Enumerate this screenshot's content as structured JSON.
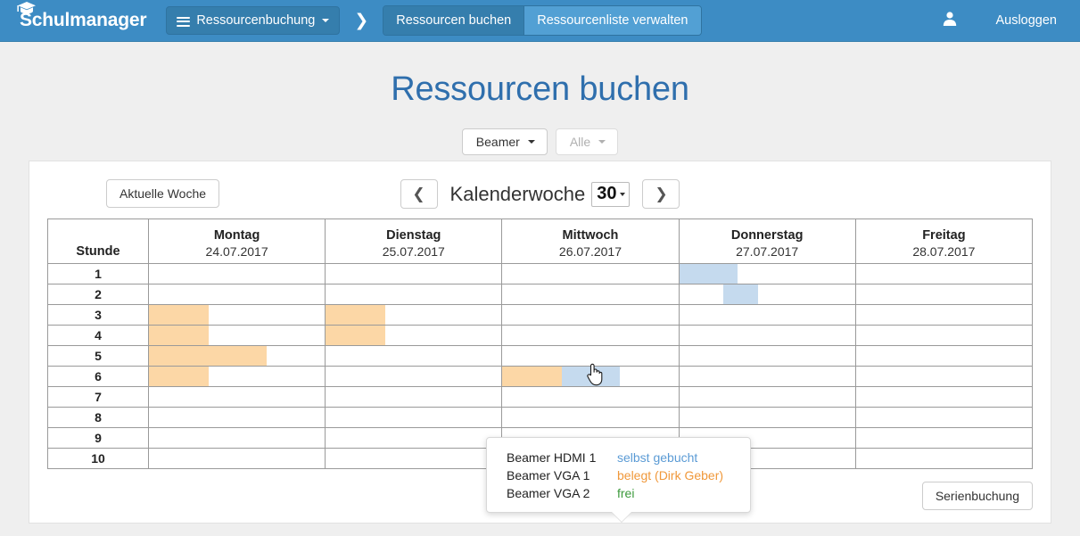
{
  "navbar": {
    "brand": "Schulmanager",
    "brand_icon": "graduation-cap-icon",
    "module_button": {
      "label": "Ressourcenbuchung",
      "icon": "bars-icon",
      "caret": "caret-down-icon"
    },
    "separator_icon": "chevron-right-icon",
    "tabs": [
      {
        "label": "Ressourcen buchen",
        "active": true
      },
      {
        "label": "Ressourcenliste verwalten",
        "active": false
      }
    ],
    "user_icon": "user-icon",
    "logout_label": "Ausloggen"
  },
  "page": {
    "title": "Ressourcen buchen",
    "filters": [
      {
        "label": "Beamer",
        "disabled": false
      },
      {
        "label": "Alle",
        "disabled": true
      }
    ]
  },
  "toolbar": {
    "current_week_label": "Aktuelle Woche",
    "prev_icon": "chevron-left-icon",
    "next_icon": "chevron-right-icon",
    "week_label": "Kalenderwoche",
    "week_number": "30",
    "series_booking_label": "Serienbuchung"
  },
  "calendar": {
    "hour_header": "Stunde",
    "days": [
      {
        "name": "Montag",
        "date": "24.07.2017"
      },
      {
        "name": "Dienstag",
        "date": "25.07.2017"
      },
      {
        "name": "Mittwoch",
        "date": "26.07.2017"
      },
      {
        "name": "Donnerstag",
        "date": "27.07.2017"
      },
      {
        "name": "Freitag",
        "date": "28.07.2017"
      }
    ],
    "hours": [
      "1",
      "2",
      "3",
      "4",
      "5",
      "6",
      "7",
      "8",
      "9",
      "10"
    ],
    "blocks": [
      {
        "hour": "1",
        "day": "Donnerstag",
        "state": "selected",
        "left_pct": 0,
        "width_pct": 33
      },
      {
        "hour": "2",
        "day": "Donnerstag",
        "state": "selected",
        "left_pct": 25,
        "width_pct": 20
      },
      {
        "hour": "3",
        "day": "Montag",
        "state": "booked",
        "left_pct": 0,
        "width_pct": 34
      },
      {
        "hour": "3",
        "day": "Dienstag",
        "state": "booked",
        "left_pct": 0,
        "width_pct": 34
      },
      {
        "hour": "4",
        "day": "Montag",
        "state": "booked",
        "left_pct": 0,
        "width_pct": 34
      },
      {
        "hour": "4",
        "day": "Dienstag",
        "state": "booked",
        "left_pct": 0,
        "width_pct": 34
      },
      {
        "hour": "5",
        "day": "Montag",
        "state": "booked",
        "left_pct": 0,
        "width_pct": 67
      },
      {
        "hour": "6",
        "day": "Montag",
        "state": "booked",
        "left_pct": 0,
        "width_pct": 34
      },
      {
        "hour": "6",
        "day": "Mittwoch",
        "state": "booked",
        "left_pct": 0,
        "width_pct": 34
      },
      {
        "hour": "6",
        "day": "Mittwoch",
        "state": "selected",
        "left_pct": 34,
        "width_pct": 33
      }
    ]
  },
  "tooltip": {
    "rows": [
      {
        "name": "Beamer HDMI 1",
        "status": "selbst gebucht",
        "color": "#5b9bd5"
      },
      {
        "name": "Beamer VGA 1",
        "status": "belegt (Dirk Geber)",
        "color": "#f0983a"
      },
      {
        "name": "Beamer VGA 2",
        "status": "frei",
        "color": "#3c9a3c"
      }
    ]
  },
  "colors": {
    "navbar": "#3d8cc4",
    "navbar_active": "#357ead",
    "title": "#2f6fad",
    "booked": "#fcd7a6",
    "selected": "#c5daee"
  },
  "cursor": {
    "icon": "pointing-hand-cursor"
  }
}
